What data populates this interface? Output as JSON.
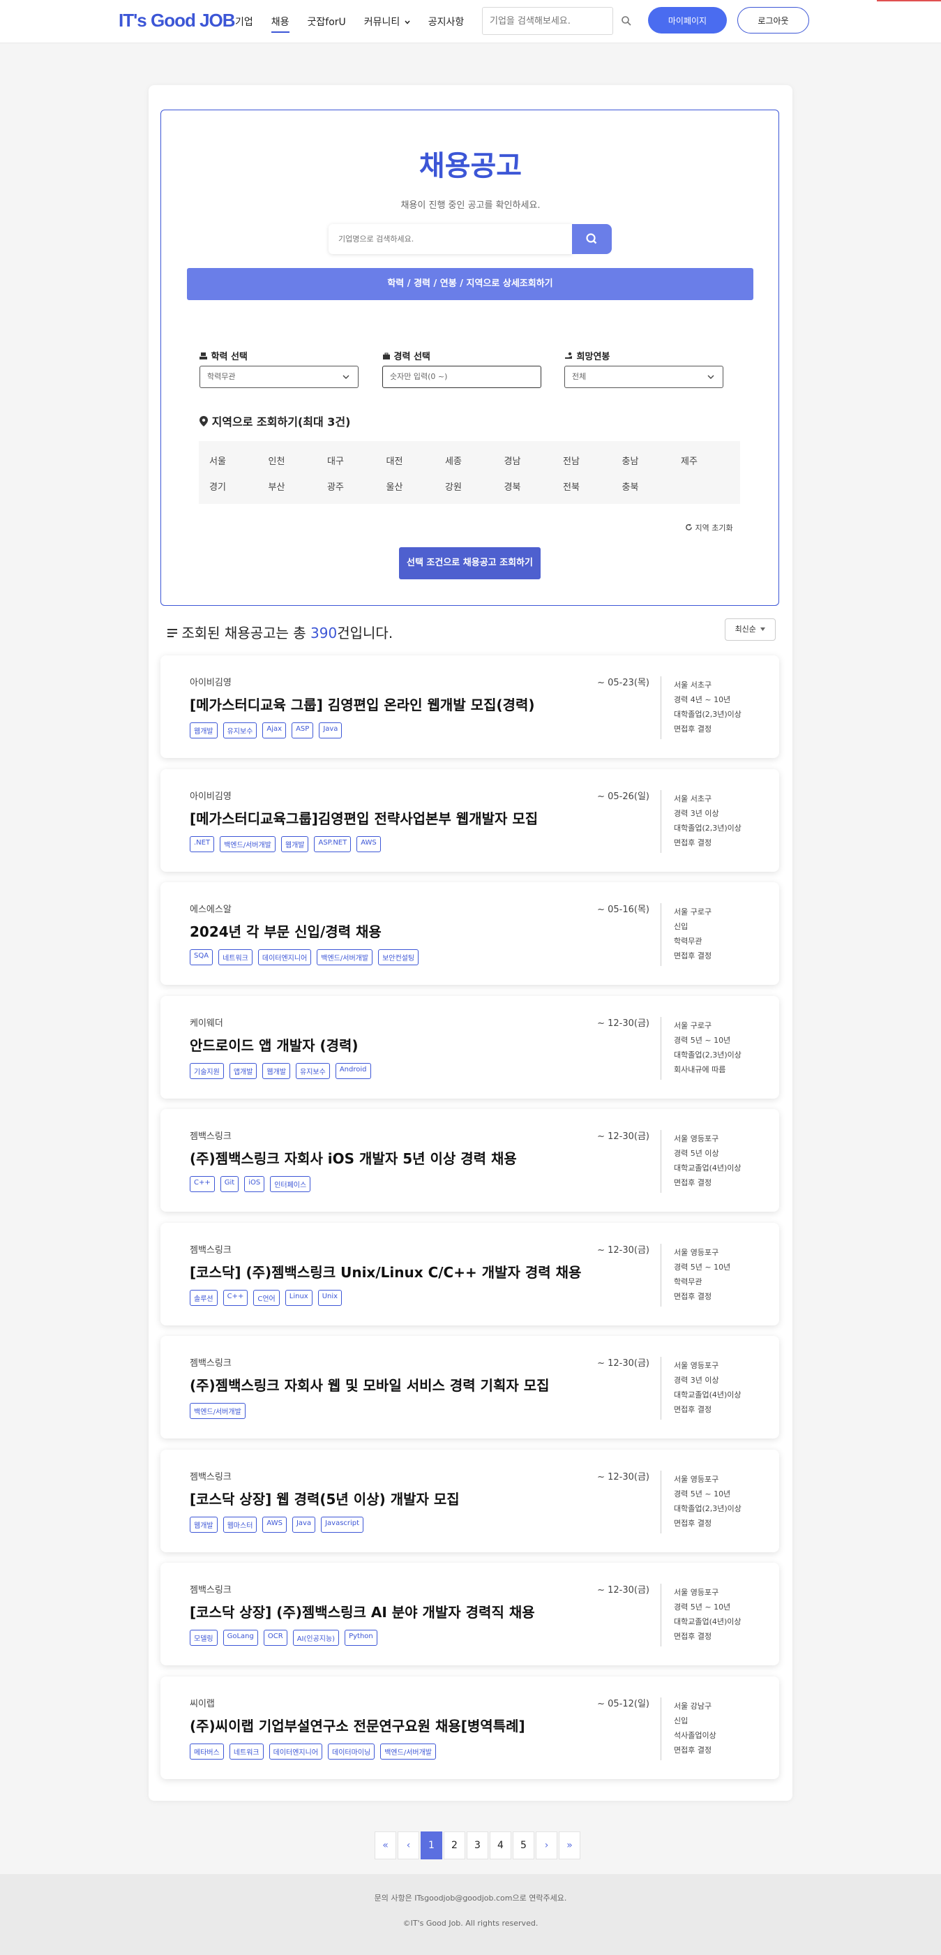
{
  "header": {
    "logo": "IT's Good JOB",
    "nav": [
      "기업",
      "채용",
      "굿잡forU",
      "커뮤니티",
      "공지사항"
    ],
    "search_placeholder": "기업을 검색해보세요.",
    "mypage_label": "마이페이지",
    "logout_label": "로그아웃"
  },
  "search": {
    "title": "채용공고",
    "subtitle": "채용이 진행 중인 공고를 확인하세요.",
    "company_placeholder": "기업명으로 검색하세요.",
    "detail_bar": "학력 / 경력 / 연봉 / 지역으로 상세조회하기",
    "education_label": "학력 선택",
    "education_value": "학력무관",
    "career_label": "경력 선택",
    "career_placeholder": "숫자만 입력(0 ~)",
    "salary_label": "희망연봉",
    "salary_value": "전체",
    "region_title": "지역으로 조회하기(최대 3건)",
    "regions_row1": [
      "서울",
      "인천",
      "대구",
      "대전",
      "세종",
      "경남",
      "전남",
      "충남",
      "제주"
    ],
    "regions_row2": [
      "경기",
      "부산",
      "광주",
      "울산",
      "강원",
      "경북",
      "전북",
      "충북"
    ],
    "region_reset": "지역 초기화",
    "submit": "선택 조건으로 채용공고 조회하기"
  },
  "results": {
    "prefix": "조회된 채용공고는 총 ",
    "count": "390",
    "suffix": "건입니다.",
    "sort": "최신순"
  },
  "jobs": [
    {
      "company": "아이비김영",
      "title": "[메가스터디교육 그룹] 김영편입 온라인 웹개발 모집(경력)",
      "tags": [
        "웹개발",
        "유지보수",
        "Ajax",
        "ASP",
        "Java"
      ],
      "deadline": "~ 05-23(목)",
      "info": [
        "서울 서초구",
        "경력 4년 ~ 10년",
        "대학졸업(2,3년)이상",
        "면접후 결정"
      ]
    },
    {
      "company": "아이비김영",
      "title": "[메가스터디교육그룹]김영편입 전략사업본부 웹개발자 모집",
      "tags": [
        ".NET",
        "백엔드/서버개발",
        "웹개발",
        "ASP.NET",
        "AWS"
      ],
      "deadline": "~ 05-26(일)",
      "info": [
        "서울 서초구",
        "경력 3년 이상",
        "대학졸업(2,3년)이상",
        "면접후 결정"
      ]
    },
    {
      "company": "에스에스알",
      "title": "2024년 각 부문 신입/경력 채용",
      "tags": [
        "SQA",
        "네트워크",
        "데이터엔지니어",
        "백엔드/서버개발",
        "보안컨설팅"
      ],
      "deadline": "~ 05-16(목)",
      "info": [
        "서울 구로구",
        "신입",
        "학력무관",
        "면접후 결정"
      ]
    },
    {
      "company": "케이웨더",
      "title": "안드로이드 앱 개발자 (경력)",
      "tags": [
        "기술지원",
        "앱개발",
        "웹개발",
        "유지보수",
        "Android"
      ],
      "deadline": "~ 12-30(금)",
      "info": [
        "서울 구로구",
        "경력 5년 ~ 10년",
        "대학졸업(2,3년)이상",
        "회사내규에 따름"
      ]
    },
    {
      "company": "젬백스링크",
      "title": "(주)젬백스링크 자회사 iOS 개발자 5년 이상 경력 채용",
      "tags": [
        "C++",
        "Git",
        "iOS",
        "인터페이스"
      ],
      "deadline": "~ 12-30(금)",
      "info": [
        "서울 영등포구",
        "경력 5년 이상",
        "대학교졸업(4년)이상",
        "면접후 결정"
      ]
    },
    {
      "company": "젬백스링크",
      "title": "[코스닥] (주)젬백스링크 Unix/Linux C/C++ 개발자 경력 채용",
      "tags": [
        "솔루션",
        "C++",
        "C언어",
        "Linux",
        "Unix"
      ],
      "deadline": "~ 12-30(금)",
      "info": [
        "서울 영등포구",
        "경력 5년 ~ 10년",
        "학력무관",
        "면접후 결정"
      ]
    },
    {
      "company": "젬백스링크",
      "title": "(주)젬백스링크 자회사 웹 및 모바일 서비스 경력 기획자 모집",
      "tags": [
        "백엔드/서버개발"
      ],
      "deadline": "~ 12-30(금)",
      "info": [
        "서울 영등포구",
        "경력 3년 이상",
        "대학교졸업(4년)이상",
        "면접후 결정"
      ]
    },
    {
      "company": "젬백스링크",
      "title": "[코스닥 상장] 웹 경력(5년 이상) 개발자 모집",
      "tags": [
        "웹개발",
        "웹마스터",
        "AWS",
        "Java",
        "Javascript"
      ],
      "deadline": "~ 12-30(금)",
      "info": [
        "서울 영등포구",
        "경력 5년 ~ 10년",
        "대학졸업(2,3년)이상",
        "면접후 결정"
      ]
    },
    {
      "company": "젬백스링크",
      "title": "[코스닥 상장] (주)젬백스링크 AI 분야 개발자 경력직 채용",
      "tags": [
        "모델링",
        "GoLang",
        "OCR",
        "AI(인공지능)",
        "Python"
      ],
      "deadline": "~ 12-30(금)",
      "info": [
        "서울 영등포구",
        "경력 5년 ~ 10년",
        "대학교졸업(4년)이상",
        "면접후 결정"
      ]
    },
    {
      "company": "씨이랩",
      "title": "(주)씨이랩 기업부설연구소 전문연구요원 채용[병역특례]",
      "tags": [
        "메타버스",
        "네트워크",
        "데이터엔지니어",
        "데이터마이닝",
        "백엔드/서버개발"
      ],
      "deadline": "~ 05-12(일)",
      "info": [
        "서울 강남구",
        "신입",
        "석사졸업이상",
        "면접후 결정"
      ]
    }
  ],
  "pagination": {
    "first": "«",
    "prev": "‹",
    "pages": [
      "1",
      "2",
      "3",
      "4",
      "5"
    ],
    "current": "1",
    "next": "›",
    "last": "»"
  },
  "footer": {
    "contact": "문의 사항은 ITsgoodjob@goodjob.com으로 연락주세요.",
    "copyright": "©IT's Good Job. All rights reserved."
  },
  "colors": {
    "brand": "#3c56d6",
    "accent": "#6a7ee8",
    "button": "#4e60cf"
  }
}
